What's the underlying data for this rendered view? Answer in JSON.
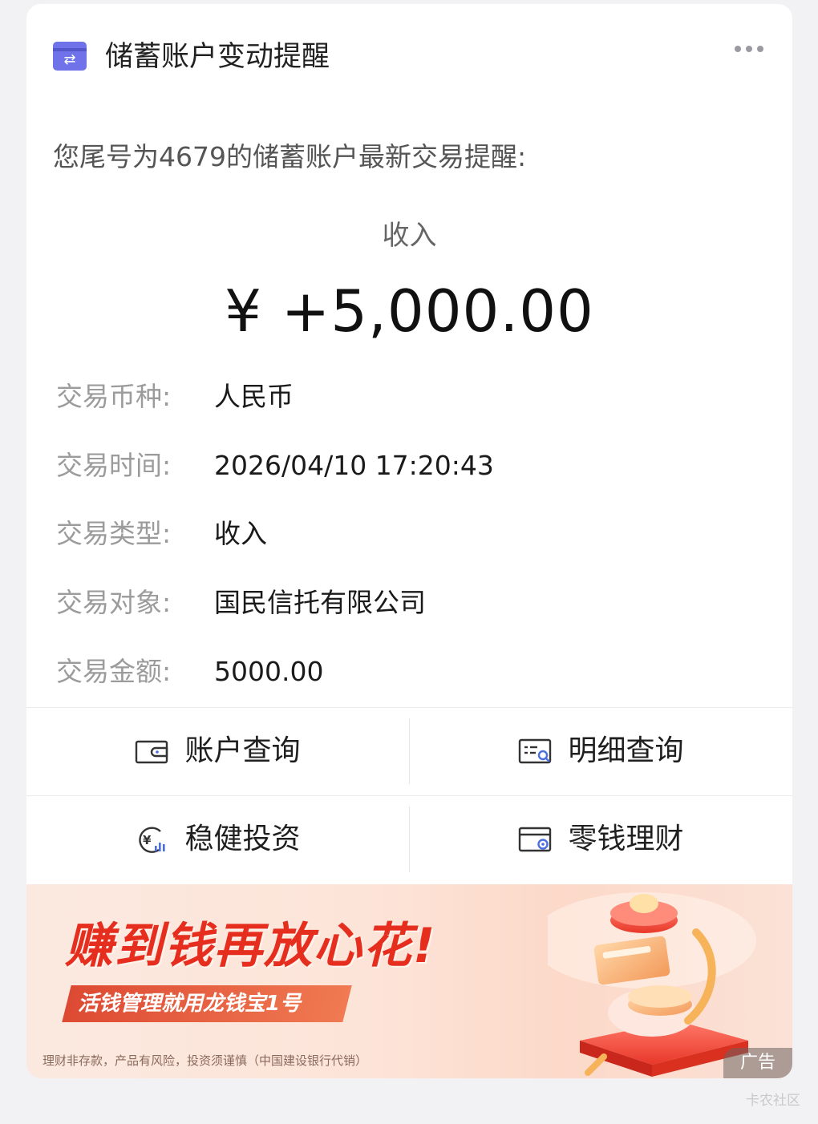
{
  "header": {
    "title": "储蓄账户变动提醒",
    "app_icon": "transfer-arrows-icon",
    "more_icon": "more-dots-icon"
  },
  "notice": {
    "intro": "您尾号为4679的储蓄账户最新交易提醒:",
    "kind": "收入",
    "amount": "¥ +5,000.00"
  },
  "details": [
    {
      "label": "交易币种:",
      "value": "人民币"
    },
    {
      "label": "交易时间:",
      "value": "2026/04/10 17:20:43"
    },
    {
      "label": "交易类型:",
      "value": "收入"
    },
    {
      "label": "交易对象:",
      "value": "国民信托有限公司"
    },
    {
      "label": "交易金额:",
      "value": "5000.00"
    }
  ],
  "actions": [
    {
      "label": "账户查询",
      "icon": "wallet-icon"
    },
    {
      "label": "明细查询",
      "icon": "statement-search-icon"
    },
    {
      "label": "稳健投资",
      "icon": "yuan-chart-icon"
    },
    {
      "label": "零钱理财",
      "icon": "card-add-icon"
    }
  ],
  "banner": {
    "slogan": "赚到钱再放心花!",
    "subtitle": "活钱管理就用龙钱宝1号",
    "disclaimer": "理财非存款，产品有风险，投资须谨慎（中国建设银行代销）",
    "ad_badge": "广告"
  },
  "watermark": "卡农社区",
  "colors": {
    "accent": "#6f72e8",
    "slogan": "#e62e1f",
    "label": "#9b9b9b"
  }
}
